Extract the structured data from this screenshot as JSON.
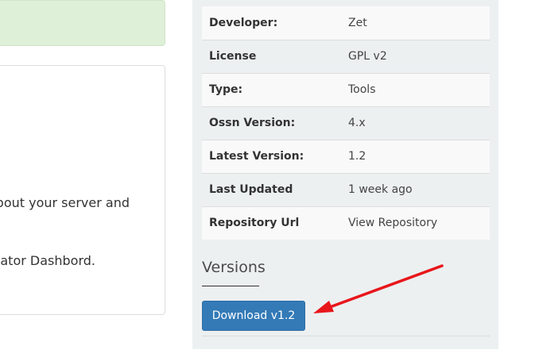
{
  "left": {
    "description_line_1": "bout your server and",
    "description_line_2": "ator Dashbord."
  },
  "info_table": [
    {
      "label": "Developer:",
      "value": "Zet"
    },
    {
      "label": "License",
      "value": "GPL v2"
    },
    {
      "label": "Type:",
      "value": "Tools"
    },
    {
      "label": "Ossn Version:",
      "value": "4.x"
    },
    {
      "label": "Latest Version:",
      "value": "1.2"
    },
    {
      "label": "Last Updated",
      "value": "1 week ago"
    },
    {
      "label": "Repository Url",
      "value": "View Repository"
    }
  ],
  "versions": {
    "heading": "Versions",
    "download_label": "Download v1.2"
  },
  "colors": {
    "success_bg": "#dff0d8",
    "sidebar_bg": "#ecf0f1",
    "button_bg": "#337ab7",
    "annotation_arrow": "#e8161b"
  },
  "icons": [
    "red-annotation-arrow"
  ]
}
